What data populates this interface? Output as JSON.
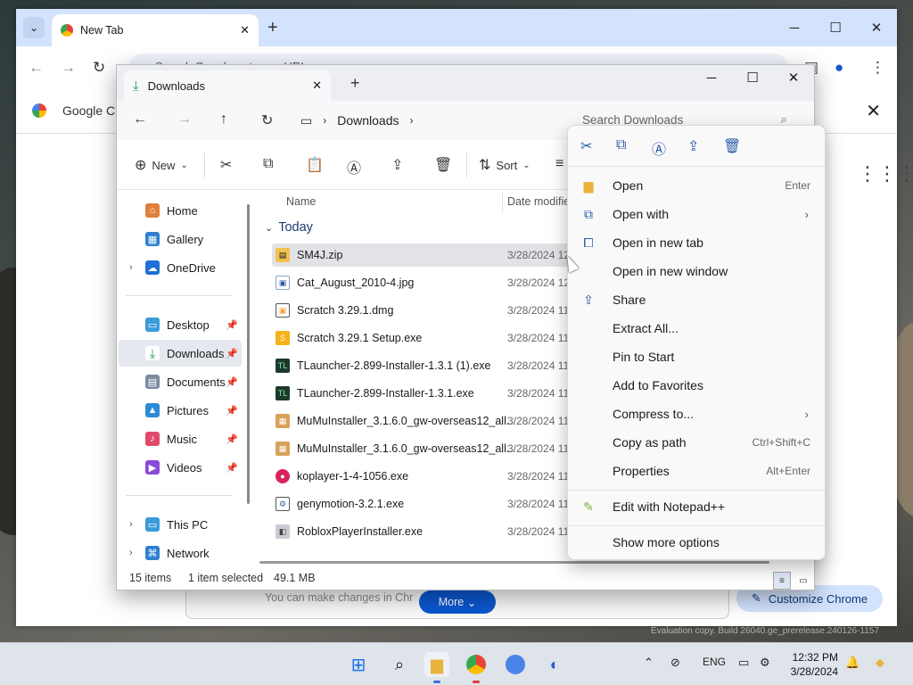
{
  "chrome": {
    "tab_title": "New Tab",
    "omnibox_text": "Search Google or type a URL",
    "bar_label": "Google Ch",
    "banner_hint": "You can make changes in Chr",
    "more_label": "More",
    "customize_label": "Customize Chrome"
  },
  "explorer": {
    "tab_title": "Downloads",
    "breadcrumb": "Downloads",
    "search_placeholder": "Search Downloads",
    "cmd": {
      "new_label": "New",
      "sort_label": "Sort"
    },
    "nav": [
      {
        "label": "Home"
      },
      {
        "label": "Gallery"
      },
      {
        "label": "OneDrive"
      },
      {
        "label": "Desktop"
      },
      {
        "label": "Downloads"
      },
      {
        "label": "Documents"
      },
      {
        "label": "Pictures"
      },
      {
        "label": "Music"
      },
      {
        "label": "Videos"
      },
      {
        "label": "This PC"
      },
      {
        "label": "Network"
      }
    ],
    "columns": {
      "name": "Name",
      "date": "Date modifie"
    },
    "group": "Today",
    "files": [
      {
        "name": "SM4J.zip",
        "date": "3/28/2024 12",
        "icon": "zip-icon"
      },
      {
        "name": "Cat_August_2010-4.jpg",
        "date": "3/28/2024 12",
        "icon": "image-file-icon"
      },
      {
        "name": "Scratch 3.29.1.dmg",
        "date": "3/28/2024 11",
        "icon": "dmg-file-icon"
      },
      {
        "name": "Scratch 3.29.1 Setup.exe",
        "date": "3/28/2024 11",
        "icon": "scratch-setup-icon"
      },
      {
        "name": "TLauncher-2.899-Installer-1.3.1 (1).exe",
        "date": "3/28/2024 11",
        "icon": "tlauncher-icon"
      },
      {
        "name": "TLauncher-2.899-Installer-1.3.1.exe",
        "date": "3/28/2024 11",
        "icon": "tlauncher-icon"
      },
      {
        "name": "MuMuInstaller_3.1.6.0_gw-overseas12_all...",
        "date": "3/28/2024 11",
        "icon": "mumu-installer-icon"
      },
      {
        "name": "MuMuInstaller_3.1.6.0_gw-overseas12_all...",
        "date": "3/28/2024 11",
        "icon": "mumu-installer-icon"
      },
      {
        "name": "koplayer-1-4-1056.exe",
        "date": "3/28/2024 11",
        "icon": "koplayer-icon"
      },
      {
        "name": "genymotion-3.2.1.exe",
        "date": "3/28/2024 11",
        "icon": "genymotion-icon"
      },
      {
        "name": "RobloxPlayerInstaller.exe",
        "date": "3/28/2024 11",
        "icon": "roblox-installer-icon"
      }
    ],
    "status": {
      "count": "15 items",
      "selection": "1 item selected",
      "size": "49.1 MB"
    }
  },
  "context_menu": {
    "items": [
      {
        "label": "Open",
        "shortcut": "Enter"
      },
      {
        "label": "Open with"
      },
      {
        "label": "Open in new tab"
      },
      {
        "label": "Open in new window"
      },
      {
        "label": "Share"
      },
      {
        "label": "Extract All..."
      },
      {
        "label": "Pin to Start"
      },
      {
        "label": "Add to Favorites"
      },
      {
        "label": "Compress to..."
      },
      {
        "label": "Copy as path",
        "shortcut": "Ctrl+Shift+C"
      },
      {
        "label": "Properties",
        "shortcut": "Alt+Enter"
      },
      {
        "label": "Edit with Notepad++"
      },
      {
        "label": "Show more options"
      }
    ]
  },
  "taskbar": {
    "lang": "ENG",
    "time": "12:32 PM",
    "date": "3/28/2024",
    "watermark": "Evaluation copy. Build 26040.ge_prerelease.240126-1157"
  }
}
